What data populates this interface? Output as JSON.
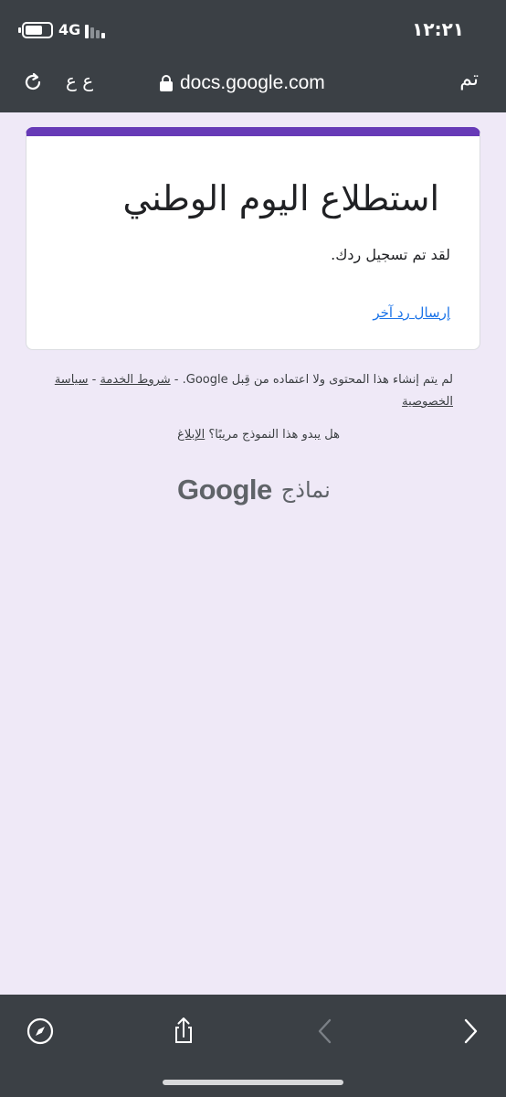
{
  "status_bar": {
    "time": "١٢:٢١",
    "network": "4G"
  },
  "browser": {
    "done_label": "تم",
    "url": "docs.google.com",
    "text_size_label": "ع ع"
  },
  "form": {
    "title": "استطلاع اليوم الوطني",
    "response_note": "لقد تم تسجيل ردك.",
    "another_response_link": "إرسال رد آخر"
  },
  "footer": {
    "disclaimer_text": "لم يتم إنشاء هذا المحتوى ولا اعتماده من قِبل Google. - ",
    "terms_link": "شروط الخدمة",
    "separator": " - ",
    "privacy_link": "سياسة الخصوصية",
    "report_question": "هل يبدو هذا النموذج مريبًا؟ ",
    "report_link": "الإبلاغ",
    "logo_google": "Google",
    "logo_forms": "نماذج"
  },
  "colors": {
    "chrome_bg": "#3b4045",
    "page_bg": "#efe9f7",
    "form_accent": "#673ab7",
    "link_blue": "#1a73e8"
  },
  "toolbar": {
    "icons": [
      "compass-icon",
      "share-icon",
      "back-arrow-icon",
      "forward-arrow-icon"
    ]
  }
}
